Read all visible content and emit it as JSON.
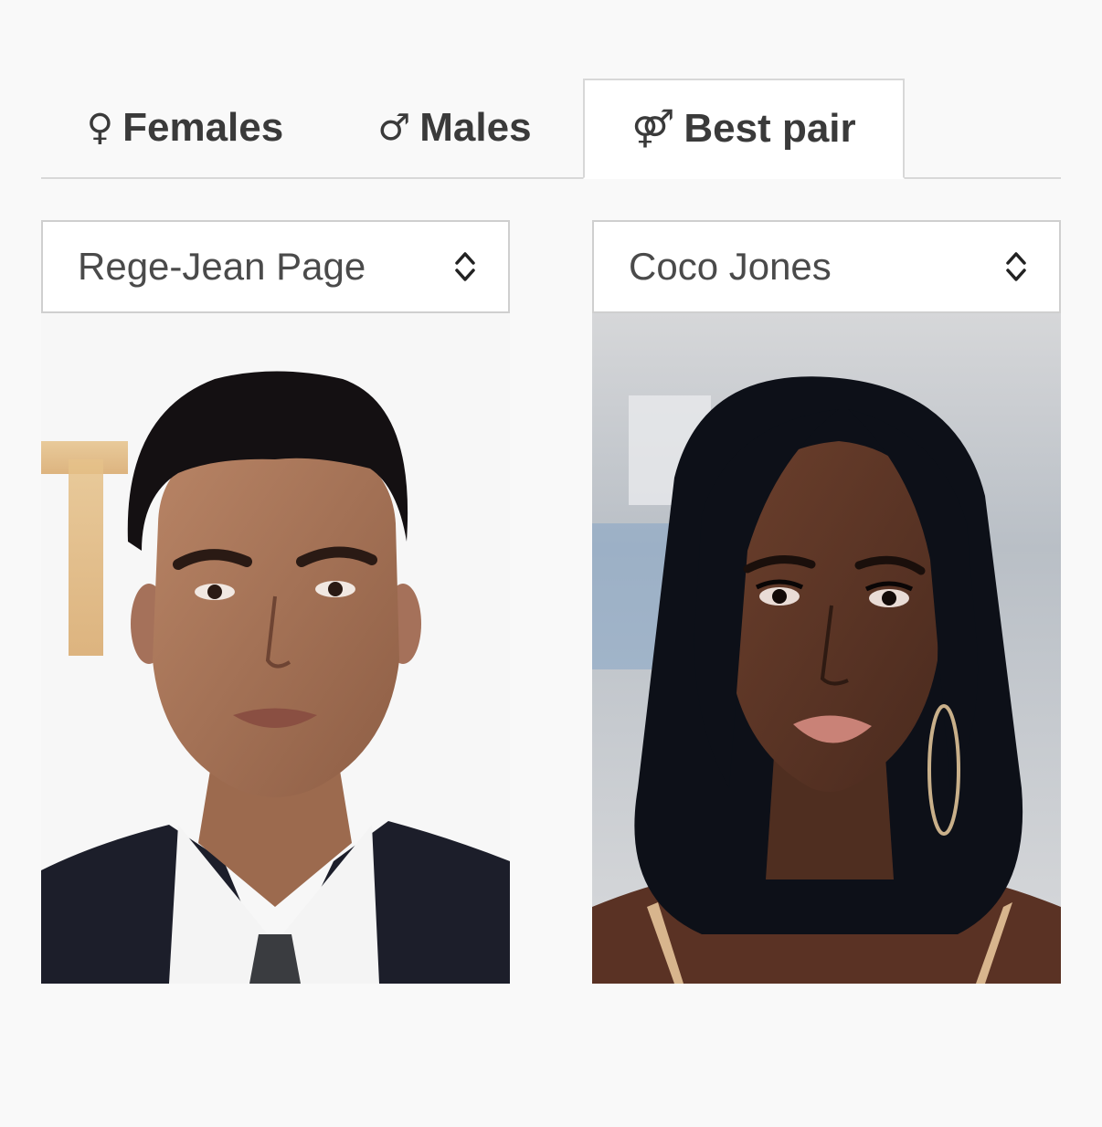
{
  "tabs": [
    {
      "symbol": "♀",
      "label": "Females",
      "active": false
    },
    {
      "symbol": "♂",
      "label": "Males",
      "active": false
    },
    {
      "symbol": "⚤",
      "label": "Best pair",
      "active": true
    }
  ],
  "selectors": {
    "left": {
      "value": "Rege-Jean Page"
    },
    "right": {
      "value": "Coco Jones"
    }
  },
  "icons": {
    "select_chevron": "chevron-up-down-icon",
    "female": "female-symbol-icon",
    "male": "male-symbol-icon",
    "pair": "pair-symbol-icon"
  },
  "colors": {
    "page_background": "#f9f9f9",
    "tab_text": "#3a3a3a",
    "border": "#d8d8d8",
    "select_text": "#4a4a4a"
  }
}
